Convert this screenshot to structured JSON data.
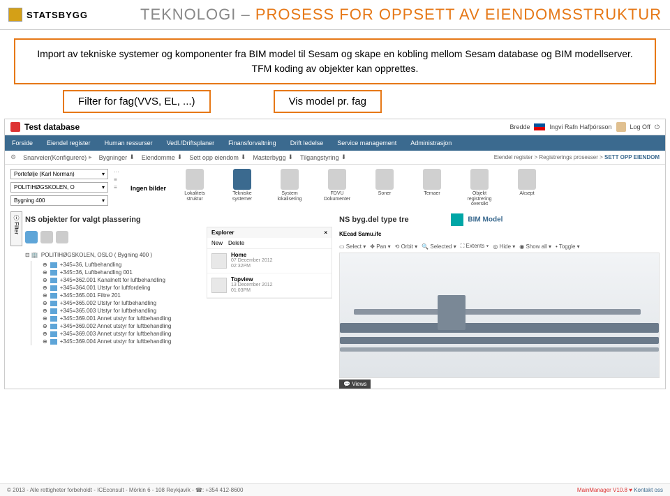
{
  "header": {
    "logo": "STATSBYGG",
    "title_gray": "TEKNOLOGI – ",
    "title_orange": "PROSESS FOR OPPSETT AV EIENDOMSSTRUKTUR"
  },
  "info_box": "Import av tekniske systemer og komponenter fra BIM model til Sesam og skape en kobling mellom Sesam database og BIM modellserver. TFM koding av objekter kan opprettes.",
  "callouts": {
    "filter": "Filter for fag(VVS, EL, ...)",
    "vis": "Vis model pr. fag"
  },
  "app": {
    "title": "Test database",
    "bredde": "Bredde",
    "user": "Ingvi Rafn Hafþórsson",
    "logoff": "Log Off"
  },
  "nav": [
    "Forside",
    "Eiendel register",
    "Human ressurser",
    "Vedl./Driftsplaner",
    "Finansforvaltning",
    "Drift ledelse",
    "Service management",
    "Administrasjon"
  ],
  "subnav": {
    "snarveier": "Snarveier(Konfigurere)",
    "items": [
      "Bygninger",
      "Eiendomme",
      "Sett opp eiendom",
      "Masterbygg",
      "Tilgangstyring"
    ]
  },
  "breadcrumb": {
    "a": "Eiendel register",
    "b": "Registrerings prosesser",
    "c": "SETT OPP EIENDOM"
  },
  "filters": {
    "portefolje": "Portefølje (Karl Norman)",
    "politi": "POLITIHØGSKOLEN, O",
    "bygning": "Bygning 400"
  },
  "no_images": "Ingen bilder",
  "icons": [
    {
      "label": "Lokalitets struktur"
    },
    {
      "label": "Tekniske systemer",
      "active": true
    },
    {
      "label": "System lokalisering"
    },
    {
      "label": "FDVU Dokumenter"
    },
    {
      "label": "Soner"
    },
    {
      "label": "Temaer"
    },
    {
      "label": "Objekt registrering oversikt"
    },
    {
      "label": "Aksept"
    }
  ],
  "filter_tab": "Filter",
  "sections": {
    "left": "NS objekter for valgt plassering",
    "right": "NS byg.del type tre",
    "bim": "BIM Model"
  },
  "tree": {
    "root": "POLITIHØGSKOLEN, OSLO ( Bygning 400 )",
    "items": [
      "+345=36, Luftbehandling",
      "+345=36, Luftbehandling 001",
      "+345=362.001 Kanalnett for luftbehandling",
      "+345=364.001 Utstyr for luftfordeling",
      "+345=365.001 Filtre 201",
      "+345=365.002 Utstyr for luftbehandling",
      "+345=365.003 Utstyr for luftbehandling",
      "+345=369.001 Annet utstyr for luftbehandling",
      "+345=369.002 Annet utstyr for luftbehandling",
      "+345=369.003 Annet utstyr for luftbehandling",
      "+345=369.004 Annet utstyr for luftbehandling"
    ]
  },
  "explorer": {
    "title": "Explorer",
    "new": "New",
    "delete": "Delete",
    "items": [
      {
        "name": "Home",
        "date": "07 December 2012",
        "time": "02:32PM"
      },
      {
        "name": "Topview",
        "date": "13 December 2012",
        "time": "01:03PM"
      }
    ]
  },
  "viewer": {
    "file": "KEcad Samu.ifc",
    "tools": [
      "Select",
      "Pan",
      "Orbit",
      "Selected",
      "Extents",
      "Hide",
      "Show all",
      "Toggle"
    ],
    "views": "Views"
  },
  "footer": {
    "copy": "© 2013 - Alle rettigheter forbeholdt - ICEconsult - Mörkin 6 - 108 Reykjavík - ☎: +354 412-8600",
    "mm": "MainManager V10.8",
    "kontakt": "Kontakt oss"
  }
}
